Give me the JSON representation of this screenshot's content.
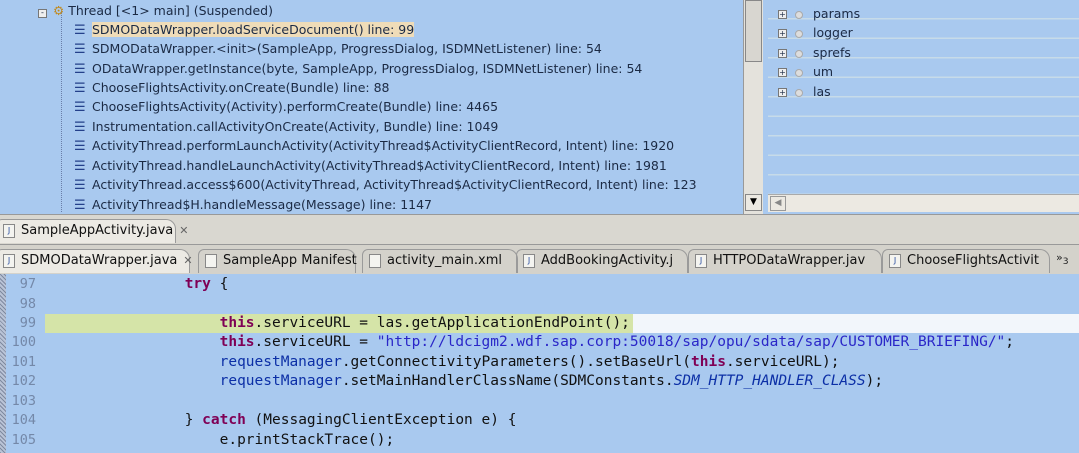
{
  "debug": {
    "thread": "Thread [<1> main] (Suspended)",
    "frames": [
      "SDMODataWrapper.loadServiceDocument() line: 99",
      "SDMODataWrapper.<init>(SampleApp, ProgressDialog, ISDMNetListener) line: 54",
      "ODataWrapper.getInstance(byte, SampleApp, ProgressDialog, ISDMNetListener) line: 54",
      "ChooseFlightsActivity.onCreate(Bundle) line: 88",
      "ChooseFlightsActivity(Activity).performCreate(Bundle) line: 4465",
      "Instrumentation.callActivityOnCreate(Activity, Bundle) line: 1049",
      "ActivityThread.performLaunchActivity(ActivityThread$ActivityClientRecord, Intent) line: 1920",
      "ActivityThread.handleLaunchActivity(ActivityThread$ActivityClientRecord, Intent) line: 1981",
      "ActivityThread.access$600(ActivityThread, ActivityThread$ActivityClientRecord, Intent) line: 123",
      "ActivityThread$H.handleMessage(Message) line: 1147"
    ]
  },
  "variables": [
    "params",
    "logger",
    "sprefs",
    "um",
    "las"
  ],
  "outer_tab": "SampleAppActivity.java",
  "editor_tabs": [
    "SDMODataWrapper.java",
    "SampleApp Manifest",
    "activity_main.xml",
    "AddBookingActivity.j",
    "HTTPODataWrapper.jav",
    "ChooseFlightsActivit"
  ],
  "overflow_count": "3",
  "line_numbers": [
    "97",
    "98",
    "99",
    "100",
    "101",
    "102",
    "103",
    "104",
    "105"
  ],
  "code": {
    "l97_kw": "try",
    " l97_rest": " {",
    "this": "this",
    "l99_rest": ".serviceURL = las.getApplicationEndPoint();",
    "l100_mid": ".serviceURL = ",
    "l100_str": "\"http://ldcigm2.wdf.sap.corp:50018/sap/opu/sdata/sap/CUSTOMER_BRIEFING/\"",
    "semi": ";",
    "requestManager": "requestManager",
    "l101_mid": ".getConnectivityParameters().setBaseUrl(",
    "l101_end": ".serviceURL);",
    "l102_mid": ".setMainHandlerClassName(SDMConstants.",
    "l102_const": "SDM_HTTP_HANDLER_CLASS",
    "l102_end": ");",
    "l104_a": "} ",
    "l104_kw": "catch",
    "l104_rest": " (MessagingClientException e) {",
    "l105": "e.printStackTrace();"
  }
}
